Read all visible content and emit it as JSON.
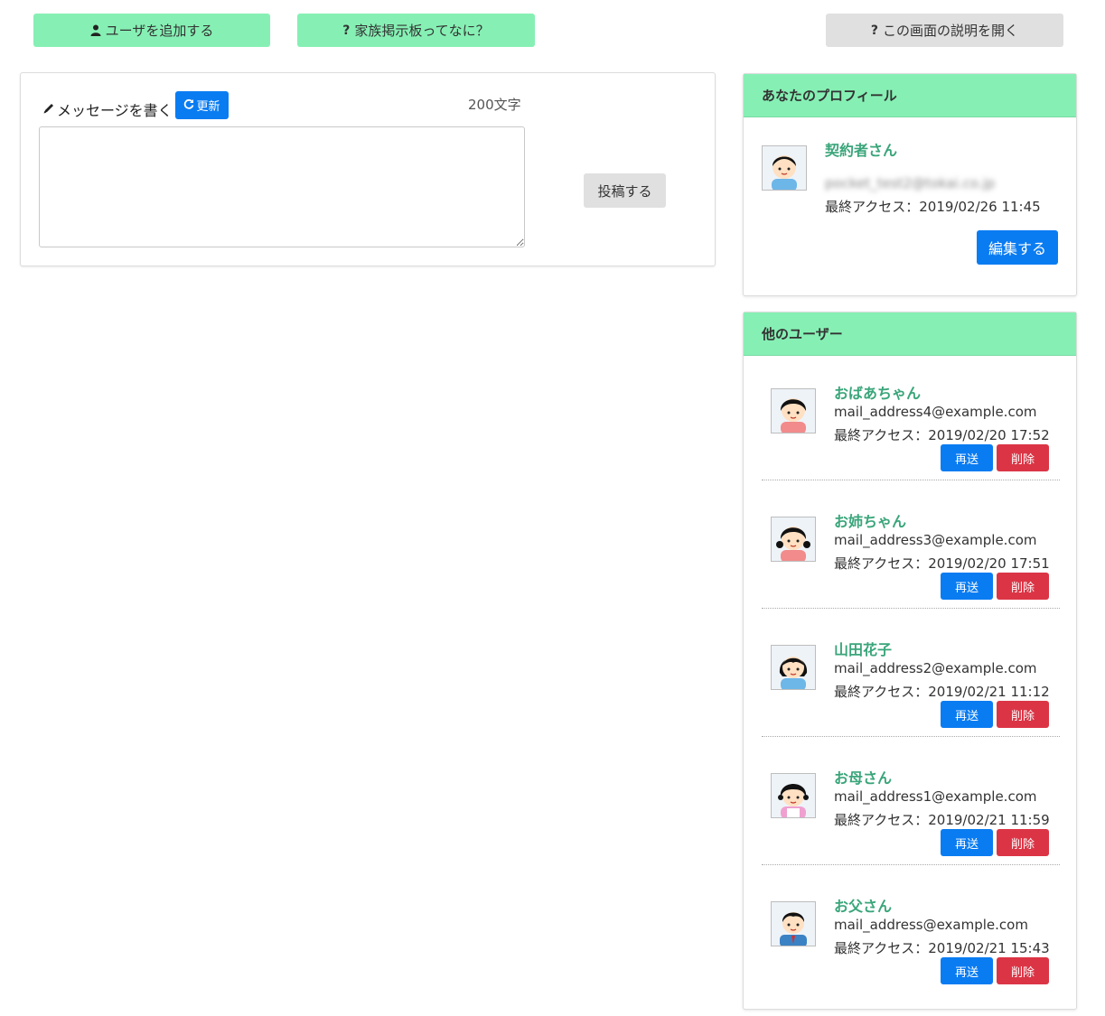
{
  "top_buttons": {
    "add_user": "ユーザを追加する",
    "what_is": "家族掲示板ってなに？",
    "help": "この画面の説明を開く"
  },
  "message": {
    "label": "メッセージを書く",
    "refresh": "更新",
    "char_count": "200文字",
    "text_value": "",
    "post": "投稿する"
  },
  "profile": {
    "header": "あなたのプロフィール",
    "name": "契約者さん",
    "email": "pocket_test2@tokai.co.jp",
    "access": "最終アクセス：2019/02/26 11:45",
    "edit": "編集する"
  },
  "others": {
    "header": "他のユーザー",
    "resend_label": "再送",
    "delete_label": "削除",
    "users": [
      {
        "name": "おばあちゃん",
        "email": "mail_address4@example.com",
        "access": "最終アクセス：2019/02/20 17:52",
        "avatar": "girl-icon"
      },
      {
        "name": "お姉ちゃん",
        "email": "mail_address3@example.com",
        "access": "最終アクセス：2019/02/20 17:51",
        "avatar": "girl-pigtails-icon"
      },
      {
        "name": "山田花子",
        "email": "mail_address2@example.com",
        "access": "最終アクセス：2019/02/21 11:12",
        "avatar": "woman-icon"
      },
      {
        "name": "お母さん",
        "email": "mail_address1@example.com",
        "access": "最終アクセス：2019/02/21 11:59",
        "avatar": "mother-icon"
      },
      {
        "name": "お父さん",
        "email": "mail_address@example.com",
        "access": "最終アクセス：2019/02/21 15:43",
        "avatar": "father-icon"
      }
    ]
  },
  "colors": {
    "green": "#86f0b4",
    "blue": "#0a7cf2",
    "red": "#db3545",
    "name_green": "#3aa57a"
  }
}
